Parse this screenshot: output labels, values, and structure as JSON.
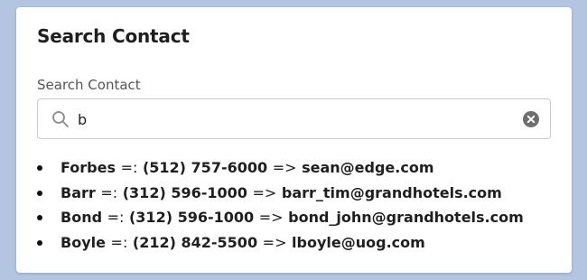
{
  "card": {
    "title": "Search Contact"
  },
  "search": {
    "label": "Search Contact",
    "value": "b",
    "icon": "search-icon",
    "clear_icon": "clear-icon"
  },
  "results": [
    {
      "name": "Forbes",
      "phone_sep": "=:",
      "phone": "(512) 757-6000",
      "email_sep": "=>",
      "email": "sean@edge.com"
    },
    {
      "name": "Barr",
      "phone_sep": "=:",
      "phone": "(312) 596-1000",
      "email_sep": "=>",
      "email": "barr_tim@grandhotels.com"
    },
    {
      "name": "Bond",
      "phone_sep": "=:",
      "phone": "(312) 596-1000",
      "email_sep": "=>",
      "email": "bond_john@grandhotels.com"
    },
    {
      "name": "Boyle",
      "phone_sep": "=:",
      "phone": "(212) 842-5500",
      "email_sep": "=>",
      "email": "lboyle@uog.com"
    }
  ],
  "colors": {
    "background": "#b3c5e1",
    "card": "#ffffff",
    "text": "#1f1f1f"
  }
}
